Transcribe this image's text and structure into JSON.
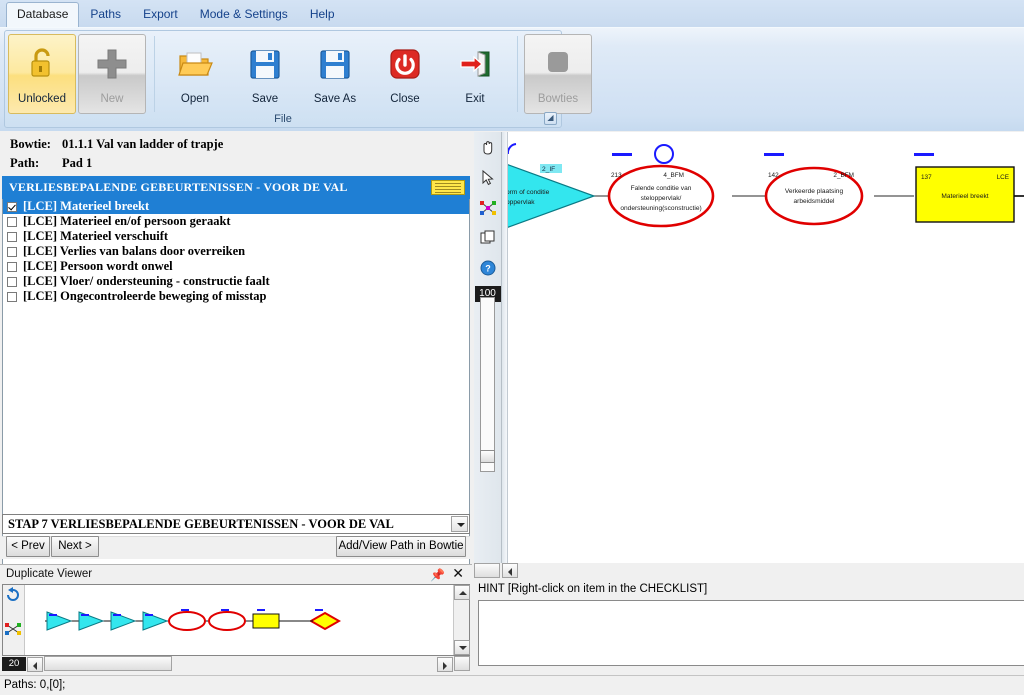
{
  "menu": {
    "tabs": [
      {
        "label": "Database",
        "active": true
      },
      {
        "label": "Paths",
        "active": false
      },
      {
        "label": "Export",
        "active": false
      },
      {
        "label": "Mode & Settings",
        "active": false
      },
      {
        "label": "Help",
        "active": false
      }
    ]
  },
  "ribbon": {
    "group_label": "File",
    "buttons": [
      {
        "label": "Unlocked",
        "icon": "open-padlock-icon",
        "state": "selected"
      },
      {
        "label": "New",
        "icon": "plus-icon",
        "state": "disabled"
      },
      {
        "label": "Open",
        "icon": "folder-open-icon",
        "state": "normal"
      },
      {
        "label": "Save",
        "icon": "floppy-disk-icon",
        "state": "normal"
      },
      {
        "label": "Save As",
        "icon": "floppy-disk-icon",
        "state": "normal"
      },
      {
        "label": "Close",
        "icon": "power-button-icon",
        "state": "normal"
      },
      {
        "label": "Exit",
        "icon": "exit-door-arrow-icon",
        "state": "normal"
      },
      {
        "label": "Bowties",
        "icon": "bowties-icon",
        "state": "disabled"
      }
    ]
  },
  "info": {
    "bowtie_key": "Bowtie:",
    "bowtie_value": "01.1.1 Val van ladder of trapje",
    "path_key": "Path:",
    "path_value": "Pad 1"
  },
  "checklist": {
    "header": "VERLIESBEPALENDE GEBEURTENISSEN - VOOR DE VAL",
    "items": [
      {
        "label": "[LCE] Materieel breekt",
        "checked": true,
        "selected": true
      },
      {
        "label": "[LCE] Materieel en/of persoon geraakt",
        "checked": false,
        "selected": false
      },
      {
        "label": "[LCE] Materieel verschuift",
        "checked": false,
        "selected": false
      },
      {
        "label": "[LCE] Verlies van balans door overreiken",
        "checked": false,
        "selected": false
      },
      {
        "label": "[LCE] Persoon wordt onwel",
        "checked": false,
        "selected": false
      },
      {
        "label": "[LCE] Vloer/ ondersteuning - constructie faalt",
        "checked": false,
        "selected": false
      },
      {
        "label": "[LCE] Ongecontroleerde beweging of misstap",
        "checked": false,
        "selected": false
      }
    ]
  },
  "step_combo": {
    "value": "STAP 7 VERLIESBEPALENDE GEBEURTENISSEN - VOOR DE VAL"
  },
  "nav": {
    "prev_label": "< Prev",
    "next_label": "Next >",
    "add_view_label": "Add/View Path in Bowtie"
  },
  "duplicate_viewer": {
    "title": "Duplicate Viewer",
    "pin_icon": "pin-icon",
    "close_icon": "close-icon",
    "zoom_level": "20",
    "refresh_icon": "refresh-icon",
    "diagram_icon": "diagram-icon"
  },
  "vtoolbar": {
    "tools": [
      {
        "name": "hand-pan-icon"
      },
      {
        "name": "arrow-select-icon"
      },
      {
        "name": "diagram-nodes-icon"
      },
      {
        "name": "copy-layers-icon"
      },
      {
        "name": "help-icon"
      }
    ],
    "zoom_level": "100"
  },
  "hint": {
    "label": "HINT [Right-click on item in the CHECKLIST]",
    "content": ""
  },
  "statusbar": {
    "text": "Paths: 0,[0];"
  },
  "diagram": {
    "nodes": [
      {
        "type": "triangle",
        "id": "2_IF",
        "text1": "orm of conditie",
        "text2": "oppervlak",
        "fill": "#33e6ee",
        "marker": "circle"
      },
      {
        "type": "ellipse",
        "id_left": "213",
        "id_right": "4_BFM",
        "line1": "Falende conditie van",
        "line2": "steloppervlak/",
        "line3": "ondersteuning(sconstructie)",
        "marker": "dash-circle"
      },
      {
        "type": "ellipse",
        "id_left": "142",
        "id_right": "2_BFM",
        "line1": "Verkeerde plaatsing",
        "line2": "arbeidsmiddel",
        "line3": "",
        "marker": "dash"
      },
      {
        "type": "box",
        "id_left": "137",
        "id_right": "LCE",
        "line1": "Materieel breekt",
        "fill": "#ffff00",
        "marker": "dash"
      }
    ]
  },
  "colors": {
    "accent_blue": "#1f7fd4",
    "ribbon_blue": "#cfe0f3",
    "node_red": "#e00000",
    "node_yellow": "#ffff00",
    "node_cyan": "#33e6ee",
    "marker_blue": "#1a1aff"
  }
}
